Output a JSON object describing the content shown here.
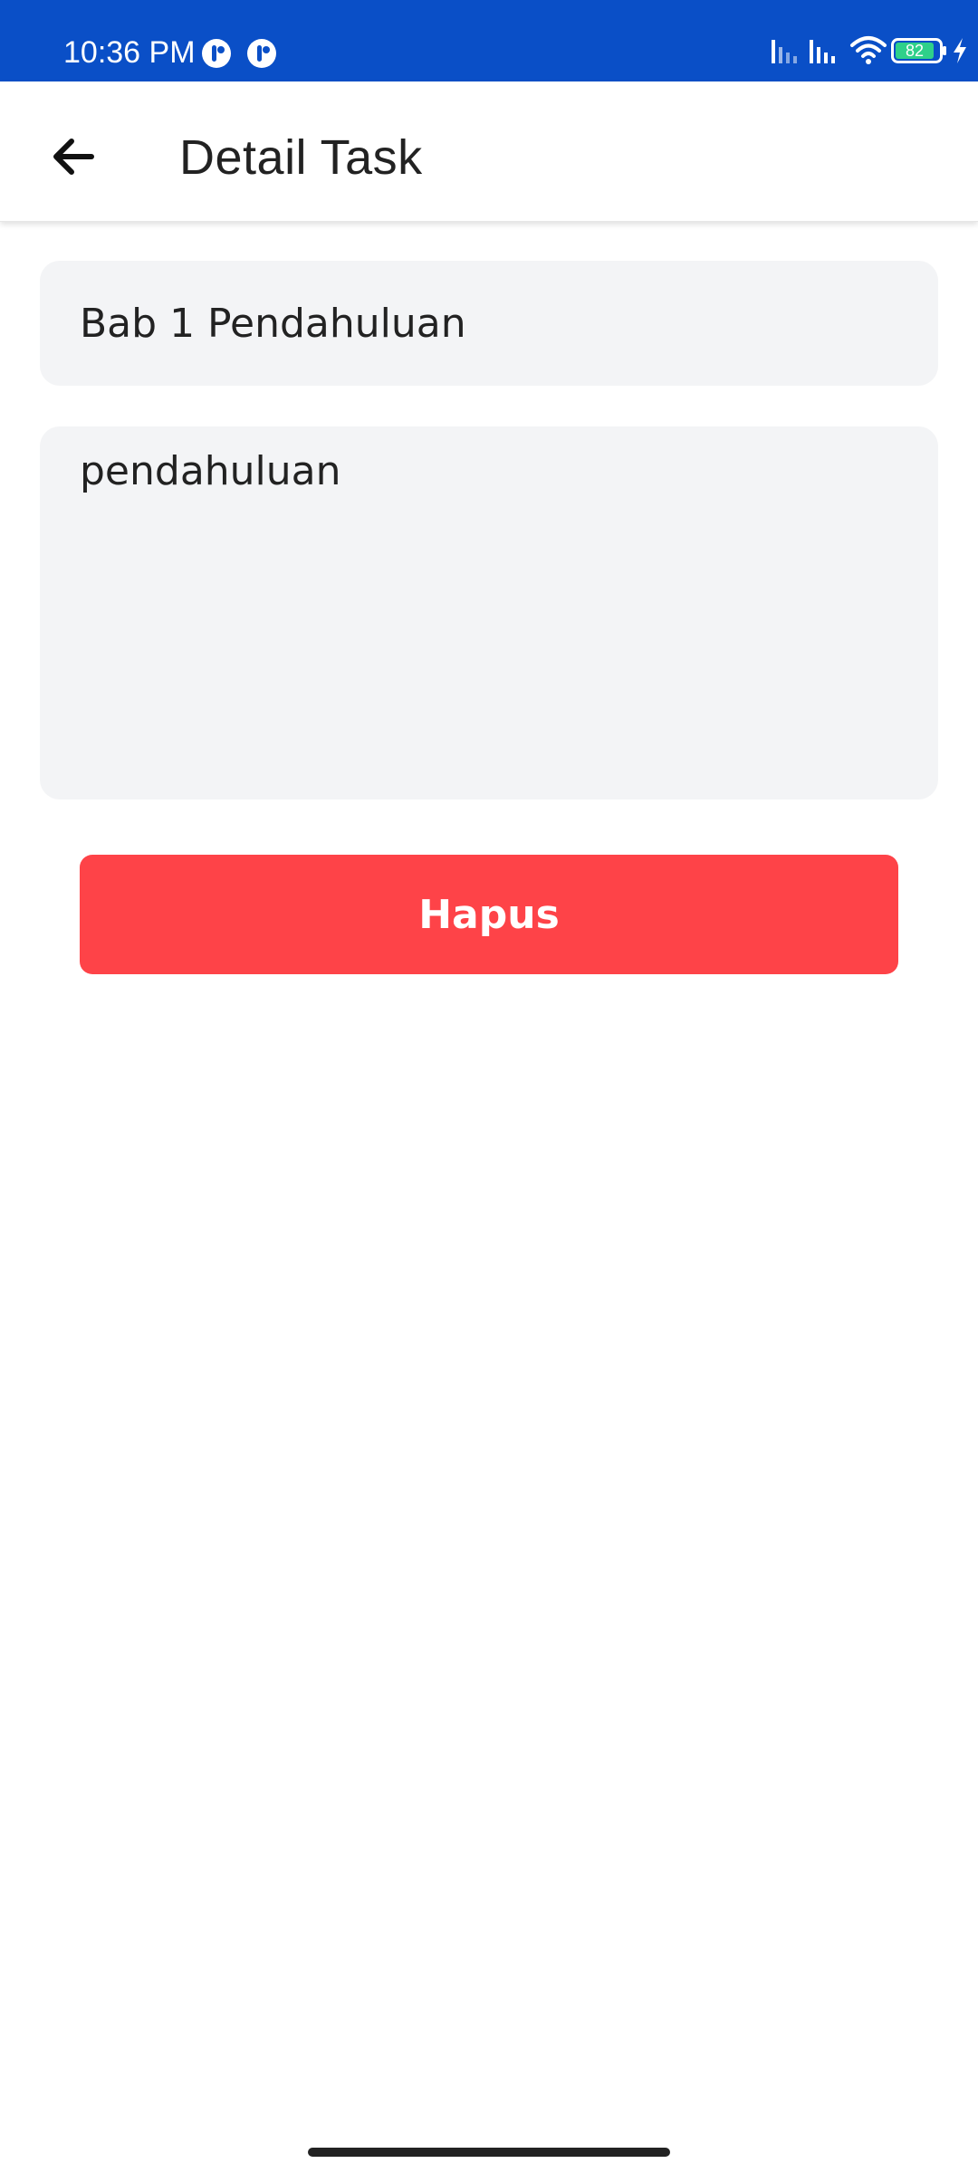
{
  "status_bar": {
    "time": "10:36 PM",
    "battery_level": "82",
    "colors": {
      "background": "#0a4fc7",
      "battery_fill": "#2fd08a"
    },
    "icons": [
      "app-notification-icon",
      "app-notification-icon",
      "signal-icon",
      "signal-icon",
      "wifi-icon",
      "battery-icon",
      "charging-icon"
    ]
  },
  "app_bar": {
    "title": "Detail Task",
    "back_icon": "arrow-left-icon"
  },
  "form": {
    "title_value": "Bab 1 Pendahuluan",
    "description_value": "pendahuluan"
  },
  "actions": {
    "delete_label": "Hapus",
    "delete_color": "#fe4348"
  }
}
